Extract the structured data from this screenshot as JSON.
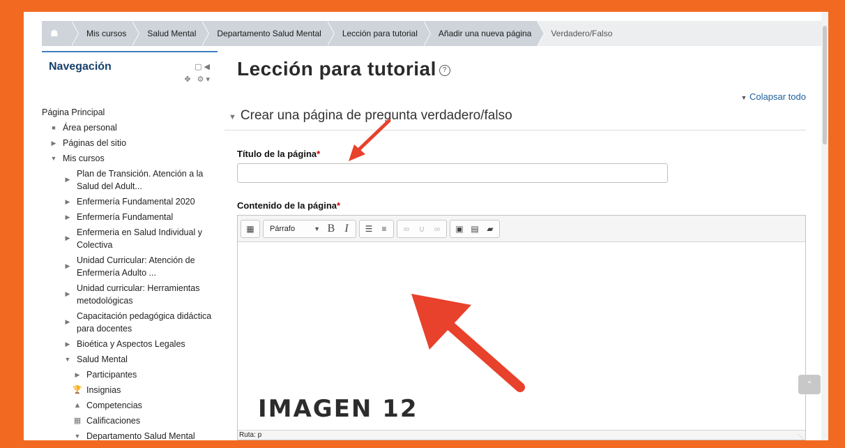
{
  "breadcrumb": {
    "items": [
      "Mis cursos",
      "Salud Mental",
      "Departamento Salud Mental",
      "Lección para tutorial",
      "Añadir una nueva página"
    ],
    "current": "Verdadero/Falso"
  },
  "sidebar": {
    "title": "Navegación",
    "items": [
      {
        "label": "Página Principal"
      },
      {
        "label": "Área personal"
      },
      {
        "label": "Páginas del sitio"
      },
      {
        "label": "Mis cursos"
      },
      {
        "label": "Plan de Transición. Atención a la Salud del Adult..."
      },
      {
        "label": "Enfermería Fundamental 2020"
      },
      {
        "label": "Enfermería Fundamental"
      },
      {
        "label": "Enfermeria en Salud Individual y Colectiva"
      },
      {
        "label": "Unidad Curricular: Atención de Enfermería Adulto ..."
      },
      {
        "label": "Unidad curricular: Herramientas metodológicas"
      },
      {
        "label": "Capacitación pedagógica didáctica para docentes"
      },
      {
        "label": "Bioética y Aspectos Legales"
      },
      {
        "label": "Salud Mental"
      },
      {
        "label": "Participantes"
      },
      {
        "label": "Insignias"
      },
      {
        "label": "Competencias"
      },
      {
        "label": "Calificaciones"
      },
      {
        "label": "Departamento Salud Mental"
      }
    ]
  },
  "main": {
    "title": "Lección para tutorial",
    "collapse_all": "Colapsar todo",
    "section_title": "Crear una página de pregunta verdadero/falso",
    "page_title_label": "Título de la página",
    "page_title_value": "",
    "page_content_label": "Contenido de la página",
    "required_mark": "*"
  },
  "editor": {
    "paragraph_select": "Párrafo",
    "status_path": "Ruta: p"
  },
  "overlay": {
    "caption": "IMAGEN 12",
    "arrow_color": "#e8412c"
  },
  "colors": {
    "frame": "#f26a21",
    "nav_title": "#163f6b",
    "link": "#1b5e9c",
    "required": "#cc0000"
  }
}
